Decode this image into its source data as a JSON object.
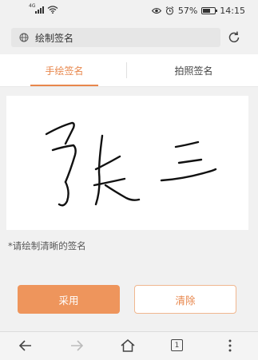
{
  "status_bar": {
    "network": "4G",
    "battery_percent_label": "57%",
    "time": "14:15"
  },
  "address_bar": {
    "title": "绘制签名"
  },
  "tabs": [
    {
      "label": "手绘签名",
      "active": true
    },
    {
      "label": "拍照签名",
      "active": false
    }
  ],
  "signature_pad": {
    "hint": "*请绘制清晰的签名"
  },
  "actions": {
    "use_label": "采用",
    "clear_label": "清除"
  },
  "nav": {
    "tab_count": "1"
  },
  "colors": {
    "accent": "#e8874c",
    "accent_fill": "#ee955c",
    "background": "#f1f1f1"
  }
}
